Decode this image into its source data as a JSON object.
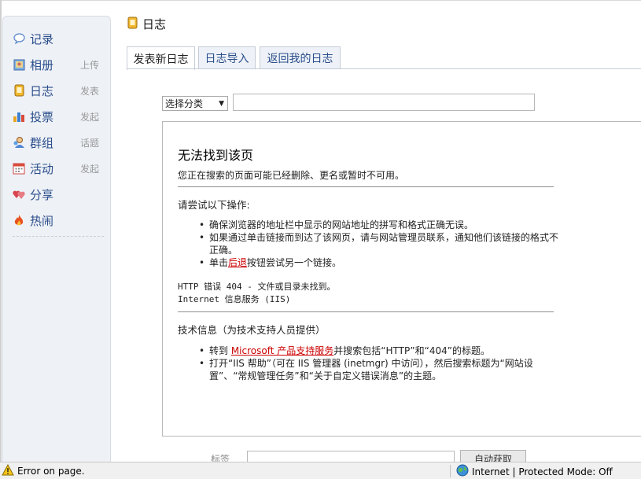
{
  "sidebar": {
    "items": [
      {
        "label": "记录",
        "sub": "",
        "icon": "speech-bubble-icon"
      },
      {
        "label": "相册",
        "sub": "上传",
        "icon": "photo-icon"
      },
      {
        "label": "日志",
        "sub": "发表",
        "icon": "diary-icon"
      },
      {
        "label": "投票",
        "sub": "发起",
        "icon": "bar-chart-icon"
      },
      {
        "label": "群组",
        "sub": "话题",
        "icon": "group-icon"
      },
      {
        "label": "活动",
        "sub": "发起",
        "icon": "calendar-icon"
      },
      {
        "label": "分享",
        "sub": "",
        "icon": "hearts-icon"
      },
      {
        "label": "热闹",
        "sub": "",
        "icon": "flame-icon"
      }
    ]
  },
  "header": {
    "title": "日志"
  },
  "tabs": [
    {
      "label": "发表新日志",
      "active": true
    },
    {
      "label": "日志导入",
      "active": false
    },
    {
      "label": "返回我的日志",
      "active": false
    }
  ],
  "form": {
    "category_value": "选择分类",
    "title_value": "",
    "tags_label": "标签",
    "tags_value": "",
    "auto_button": "自动获取"
  },
  "error_page": {
    "title": "无法找到该页",
    "description": "您正在搜索的页面可能已经删除、更名或暂时不可用。",
    "try_heading": "请尝试以下操作:",
    "try_items": {
      "item1": "确保浏览器的地址栏中显示的网站地址的拼写和格式正确无误。",
      "item2": "如果通过单击链接而到达了该网页，请与网站管理员联系，通知他们该链接的格式不正确。",
      "item3_prefix": "单击",
      "item3_link": "后退",
      "item3_suffix": "按钮尝试另一个链接。"
    },
    "http_error": "HTTP 错误 404 - 文件或目录未找到。",
    "iis_label": "Internet 信息服务 (IIS)",
    "tech_heading": "技术信息（为技术支持人员提供）",
    "tech_items": {
      "item1_prefix": "转到 ",
      "item1_link": "Microsoft 产品支持服务",
      "item1_suffix": "并搜索包括“HTTP”和“404”的标题。",
      "item2": "打开“IIS 帮助”（可在 IIS 管理器 (inetmgr) 中访问），然后搜索标题为“网站设置”、“常规管理任务”和“关于自定义错误消息”的主题。"
    }
  },
  "statusbar": {
    "left_text": "Error on page.",
    "zone_text": "Internet | Protected Mode: Off"
  },
  "colors": {
    "link": "#2b4e8c",
    "error_link": "#cc0000",
    "sidebar_bg": "#eef1f6"
  }
}
